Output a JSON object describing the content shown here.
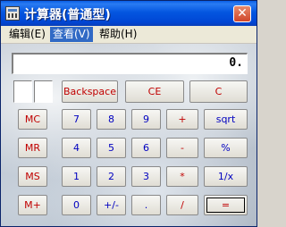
{
  "window": {
    "title": "计算器(普通型)",
    "close_glyph": "✕"
  },
  "menu": {
    "items": [
      {
        "label": "编辑(E)"
      },
      {
        "label": "查看(V)"
      },
      {
        "label": "帮助(H)"
      }
    ]
  },
  "display": {
    "value": "0."
  },
  "edit_buttons": {
    "backspace": "Backspace",
    "ce": "CE",
    "c": "C"
  },
  "memory_buttons": {
    "mc": "MC",
    "mr": "MR",
    "ms": "MS",
    "mplus": "M+"
  },
  "keys": {
    "row1": [
      "7",
      "8",
      "9",
      "+",
      "sqrt"
    ],
    "row2": [
      "4",
      "5",
      "6",
      "-",
      "%"
    ],
    "row3": [
      "1",
      "2",
      "3",
      "*",
      "1/x"
    ],
    "row4": [
      "0",
      "+/-",
      ".",
      "/",
      "="
    ]
  },
  "colors": {
    "title_bar": "#0054e3",
    "digit_text": "#0000c0",
    "operator_text": "#c00000",
    "menu_highlight": "#316ac5"
  }
}
